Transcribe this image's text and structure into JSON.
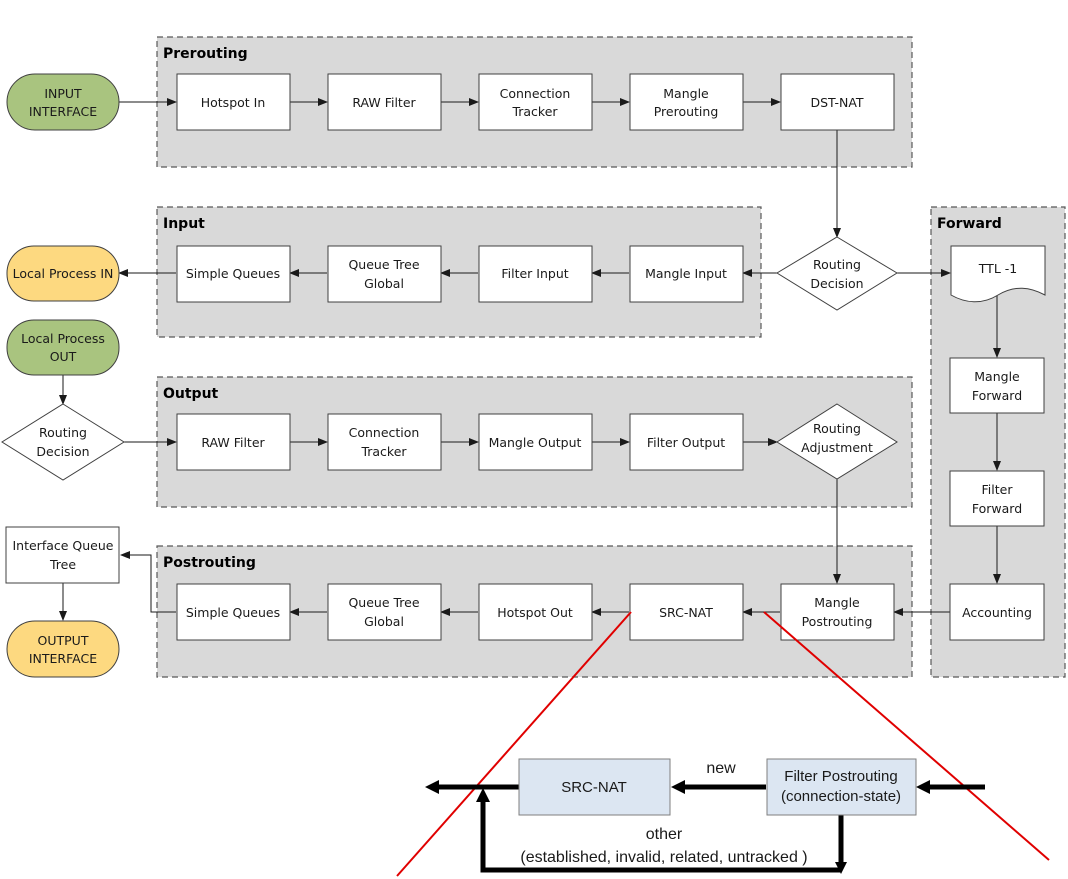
{
  "groups": {
    "prerouting": "Prerouting",
    "input": "Input",
    "output": "Output",
    "postrouting": "Postrouting",
    "forward": "Forward"
  },
  "terminals": {
    "input_interface": [
      "INPUT",
      "INTERFACE"
    ],
    "local_process_in": [
      "Local Process IN"
    ],
    "local_process_out": [
      "Local Process",
      "OUT"
    ],
    "output_interface": [
      "OUTPUT",
      "INTERFACE"
    ]
  },
  "prerouting_steps": [
    [
      "Hotspot In"
    ],
    [
      "RAW Filter"
    ],
    [
      "Connection",
      "Tracker"
    ],
    [
      "Mangle",
      "Prerouting"
    ],
    [
      "DST-NAT"
    ]
  ],
  "input_steps": [
    [
      "Simple Queues"
    ],
    [
      "Queue Tree",
      "Global"
    ],
    [
      "Filter Input"
    ],
    [
      "Mangle Input"
    ]
  ],
  "output_steps": [
    [
      "RAW Filter"
    ],
    [
      "Connection",
      "Tracker"
    ],
    [
      "Mangle Output"
    ],
    [
      "Filter Output"
    ]
  ],
  "postrouting_steps": [
    [
      "Simple Queues"
    ],
    [
      "Queue Tree",
      "Global"
    ],
    [
      "Hotspot Out"
    ],
    [
      "SRC-NAT"
    ],
    [
      "Mangle",
      "Postrouting"
    ]
  ],
  "forward_steps": [
    [
      "TTL -1"
    ],
    [
      "Mangle",
      "Forward"
    ],
    [
      "Filter",
      "Forward"
    ],
    [
      "Accounting"
    ]
  ],
  "decisions": {
    "routing_decision_main": [
      "Routing",
      "Decision"
    ],
    "routing_decision_local": [
      "Routing",
      "Decision"
    ],
    "routing_adjustment": [
      "Routing",
      "Adjustment"
    ]
  },
  "interface_queue_tree": [
    "Interface Queue",
    "Tree"
  ],
  "detail": {
    "src_nat": "SRC-NAT",
    "filter_postrouting": [
      "Filter Postrouting",
      "(connection-state)"
    ],
    "new_label": "new",
    "other_label": "other",
    "other_states": "(established, invalid, related, untracked )"
  },
  "colors": {
    "terminal_green": "#a9c47f",
    "terminal_yellow": "#fdd980",
    "group_fill": "#d9d9d9",
    "detail_fill": "#dce6f2",
    "zoom_line": "#e00000"
  }
}
